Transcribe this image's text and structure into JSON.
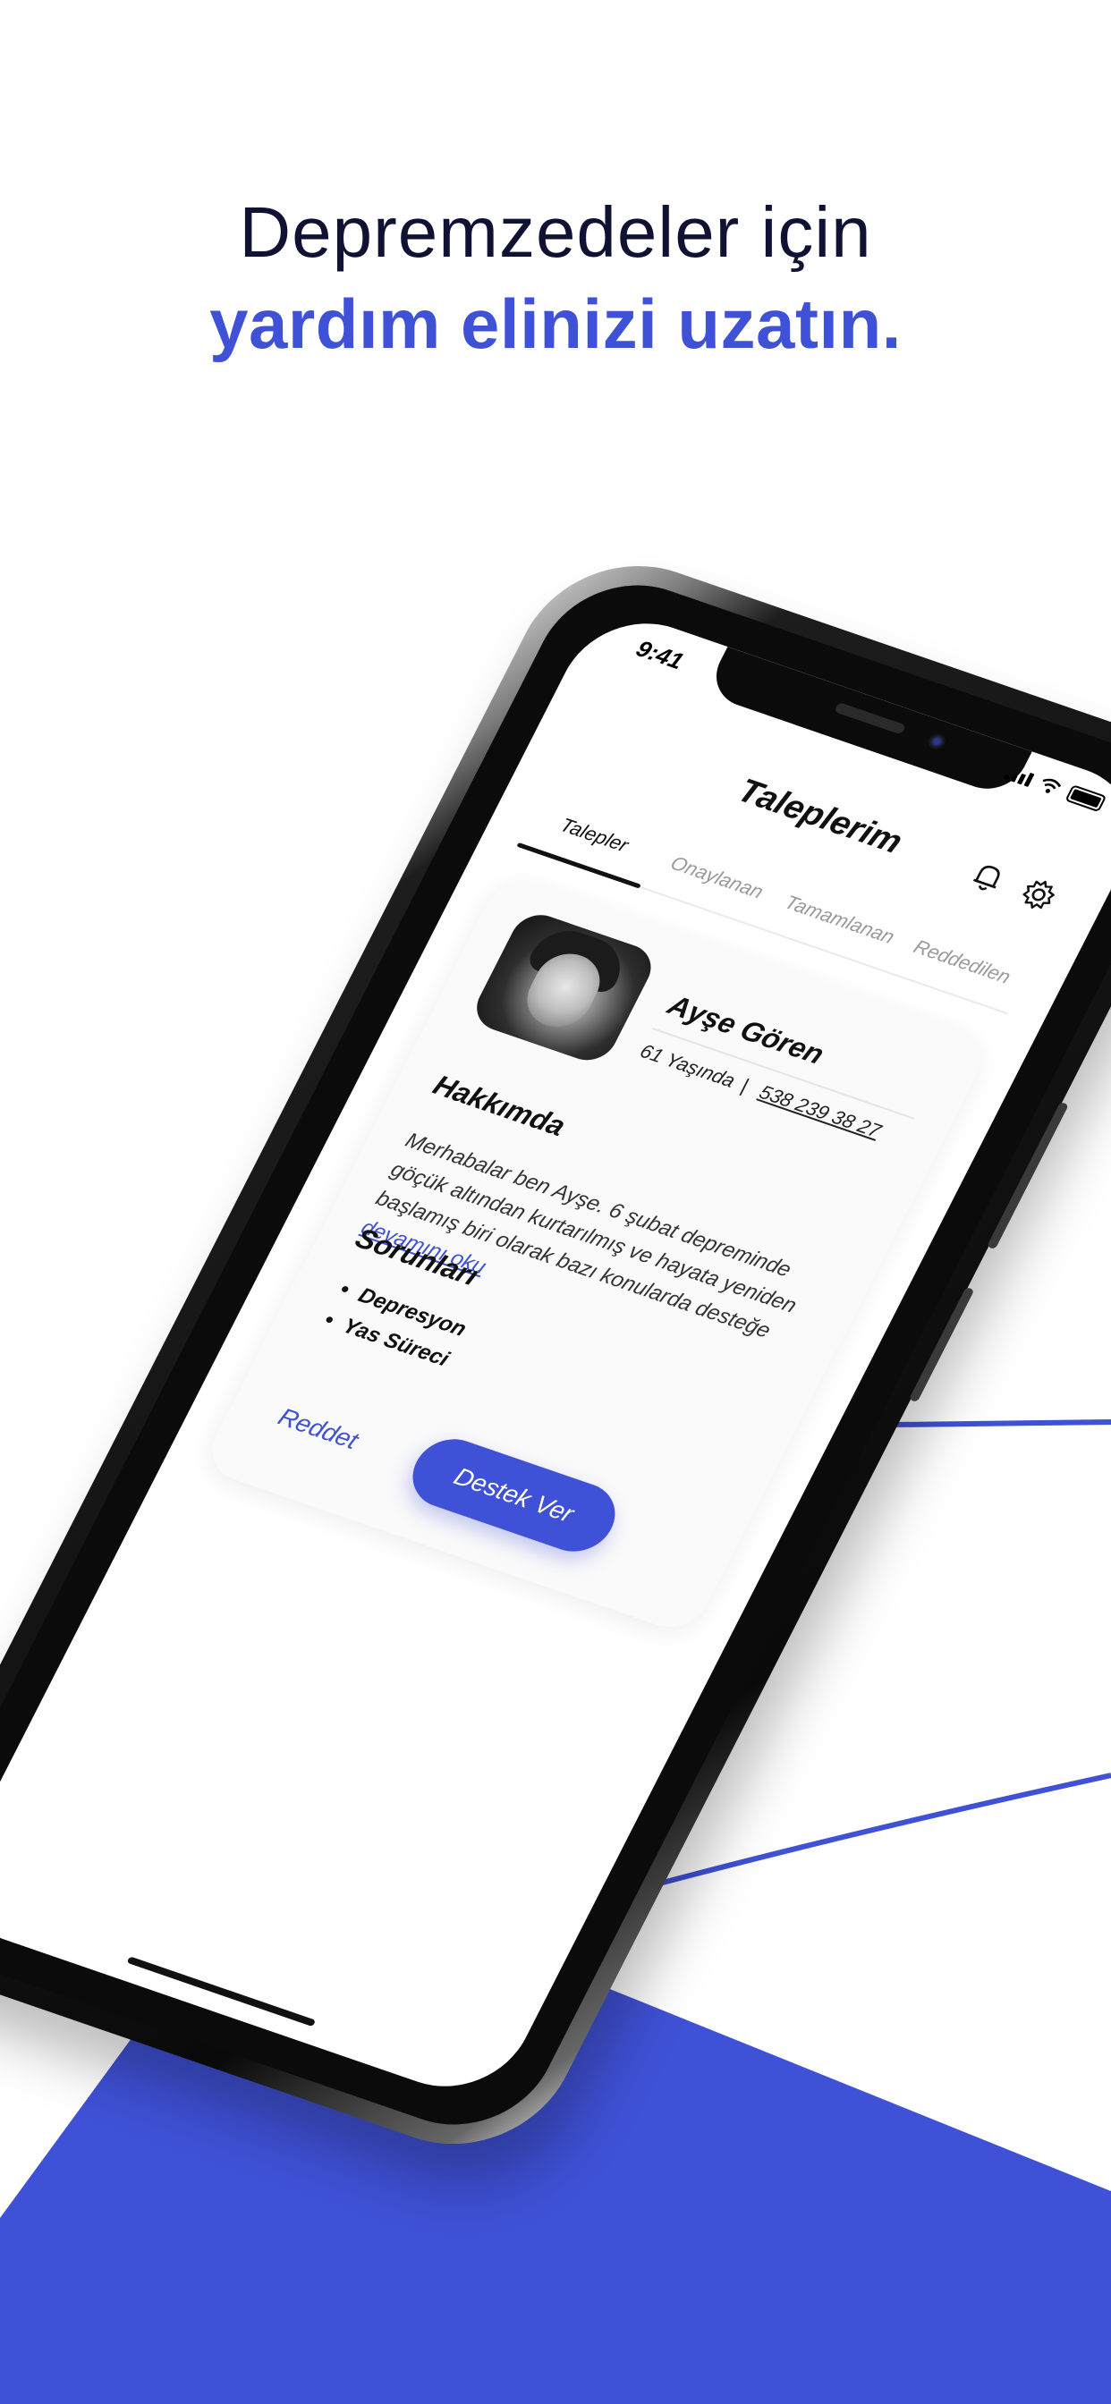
{
  "headline": {
    "line1": "Depremzedeler için",
    "line2": "yardım elinizi uzatın."
  },
  "colors": {
    "accent": "#3f51d6",
    "dark_text": "#0f1233",
    "background": "#ffffff"
  },
  "status_bar": {
    "time": "9:41",
    "icons": [
      "signal-icon",
      "wifi-icon",
      "battery-icon"
    ]
  },
  "app": {
    "title": "Taleplerim",
    "header_icons": [
      "bell-icon",
      "gear-icon"
    ],
    "tabs": [
      {
        "label": "Talepler",
        "active": true
      },
      {
        "label": "Onaylanan",
        "active": false
      },
      {
        "label": "Tamamlanan",
        "active": false
      },
      {
        "label": "Reddedilen",
        "active": false
      }
    ],
    "card": {
      "name": "Ayşe Gören",
      "age": "61 Yaşında",
      "separator": "|",
      "phone": "538 239 38 27",
      "about_title": "Hakkımda",
      "about_text": "Merhabalar ben Ayşe. 6 şubat depreminde göçük altından kurtarılmış ve hayata yeniden başlamış biri olarak bazı konularda desteğe",
      "read_more": "devamını oku",
      "issues_title": "Sorunları",
      "issues": [
        "Depresyon",
        "Yas Süreci"
      ],
      "reject_label": "Reddet",
      "support_label": "Destek Ver"
    }
  }
}
